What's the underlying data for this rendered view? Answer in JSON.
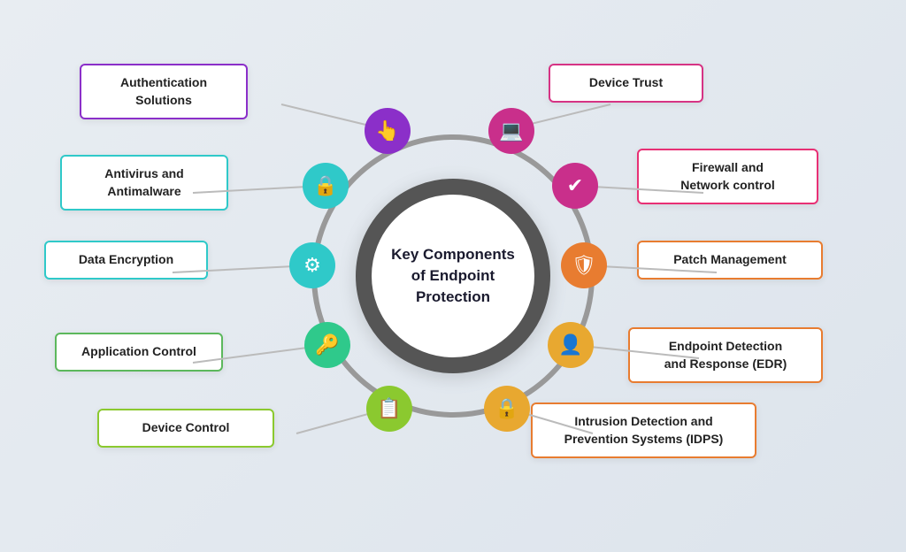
{
  "title": "Key Components of Endpoint Protection",
  "center": {
    "line1": "Key Components",
    "line2": "of Endpoint",
    "line3": "Protection"
  },
  "items": [
    {
      "id": "authentication",
      "label": "Authentication\nSolutions",
      "icon": "👆",
      "iconBg": "purple",
      "boxBorder": "border-purple",
      "angle": -130,
      "radius": 170
    },
    {
      "id": "device-trust",
      "label": "Device Trust",
      "icon": "💻",
      "iconBg": "magenta",
      "boxBorder": "border-magenta",
      "angle": -60,
      "radius": 170
    },
    {
      "id": "antivirus",
      "label": "Antivirus and\nAntimalware",
      "icon": "🔒",
      "iconBg": "teal",
      "boxBorder": "border-teal",
      "angle": -170,
      "radius": 170
    },
    {
      "id": "firewall",
      "label": "Firewall and\nNetwork control",
      "icon": "✅",
      "iconBg": "magenta",
      "boxBorder": "border-pink",
      "angle": -20,
      "radius": 170
    },
    {
      "id": "data-encryption",
      "label": "Data Encryption",
      "icon": "⚙",
      "iconBg": "teal",
      "boxBorder": "border-teal2",
      "angle": 175,
      "radius": 170
    },
    {
      "id": "patch-management",
      "label": "Patch Management",
      "icon": "🛡",
      "iconBg": "orange",
      "boxBorder": "border-orange",
      "angle": 20,
      "radius": 170
    },
    {
      "id": "application-control",
      "label": "Application Control",
      "icon": "🔑",
      "iconBg": "teal-green",
      "boxBorder": "border-green",
      "angle": 140,
      "radius": 170
    },
    {
      "id": "edr",
      "label": "Endpoint Detection\nand Response (EDR)",
      "icon": "👤",
      "iconBg": "yellow-orange",
      "boxBorder": "border-orange",
      "angle": 55,
      "radius": 170
    },
    {
      "id": "device-control",
      "label": "Device Control",
      "icon": "📋",
      "iconBg": "olive",
      "boxBorder": "border-lime",
      "angle": 110,
      "radius": 170
    },
    {
      "id": "idps",
      "label": "Intrusion Detection and\nPrevention Systems (IDPS)",
      "icon": "🔒",
      "iconBg": "yellow-orange",
      "boxBorder": "border-orange",
      "angle": 85,
      "radius": 170
    }
  ]
}
